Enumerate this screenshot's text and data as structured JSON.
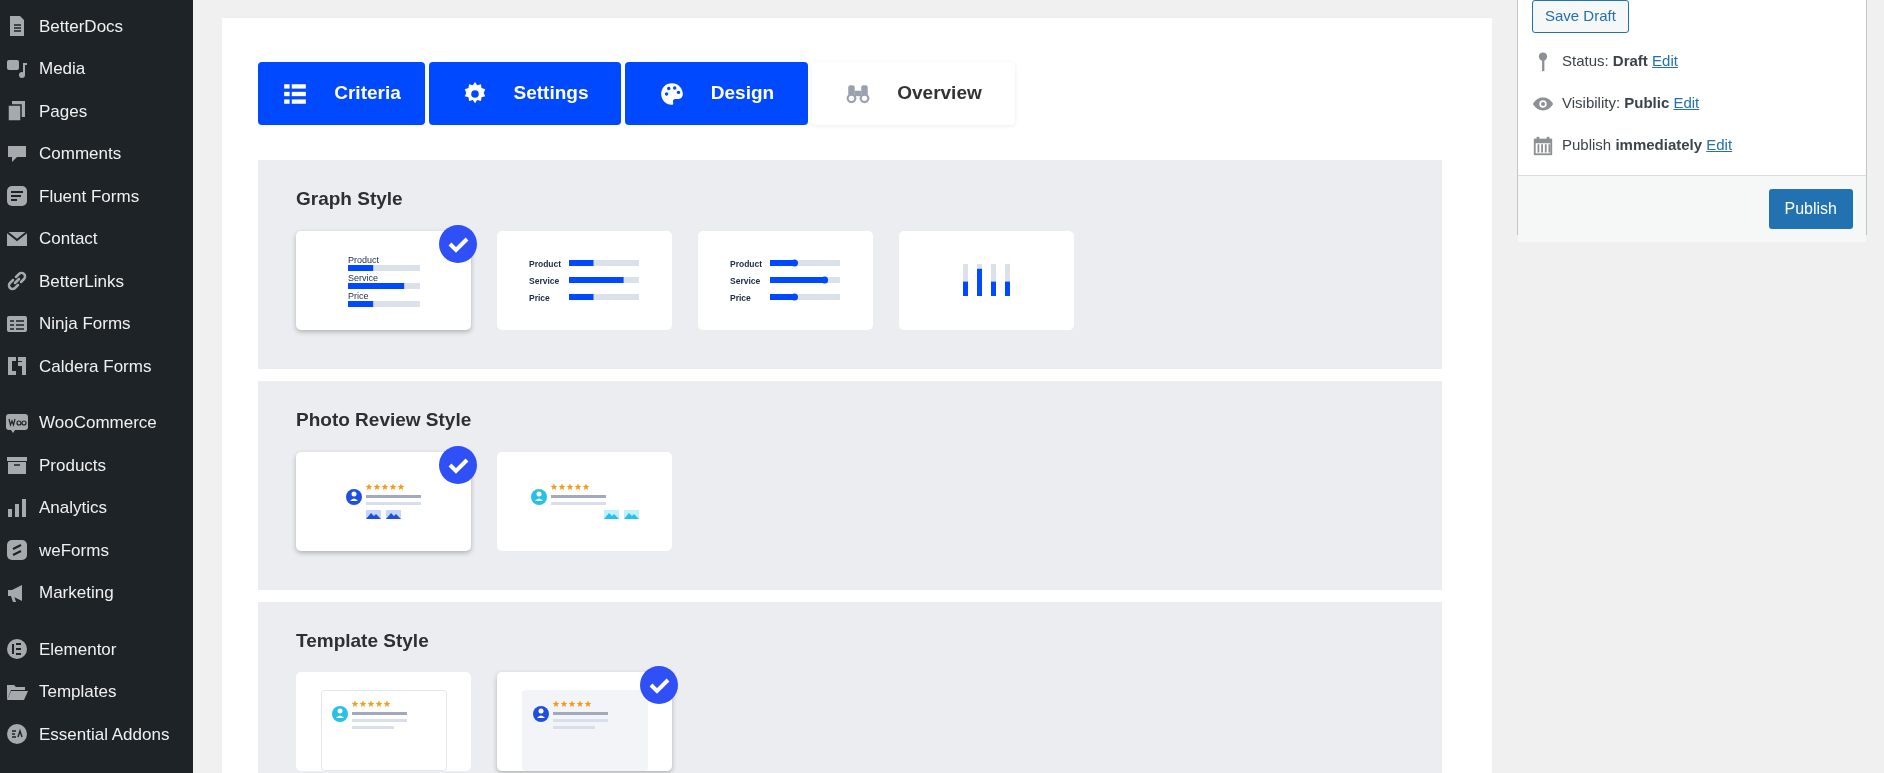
{
  "sidebar": {
    "items": [
      {
        "label": "BetterDocs"
      },
      {
        "label": "Media"
      },
      {
        "label": "Pages"
      },
      {
        "label": "Comments"
      },
      {
        "label": "Fluent Forms"
      },
      {
        "label": "Contact"
      },
      {
        "label": "BetterLinks"
      },
      {
        "label": "Ninja Forms"
      },
      {
        "label": "Caldera Forms"
      },
      {
        "label": "WooCommerce"
      },
      {
        "label": "Products"
      },
      {
        "label": "Analytics"
      },
      {
        "label": "weForms"
      },
      {
        "label": "Marketing"
      },
      {
        "label": "Elementor"
      },
      {
        "label": "Templates"
      },
      {
        "label": "Essential Addons"
      }
    ]
  },
  "tabs": [
    {
      "label": "Criteria",
      "active": true
    },
    {
      "label": "Settings",
      "active": true
    },
    {
      "label": "Design",
      "active": true
    },
    {
      "label": "Overview",
      "active": false
    }
  ],
  "sections": [
    {
      "title": "Graph Style",
      "kind": "graph",
      "options": [
        {
          "kind": "stacked",
          "selected": true,
          "labels": [
            "Product",
            "Service",
            "Price"
          ]
        },
        {
          "kind": "inline",
          "selected": false,
          "labels": [
            "Product",
            "Service",
            "Price"
          ]
        },
        {
          "kind": "slider",
          "selected": false,
          "labels": [
            "Product",
            "Service",
            "Price"
          ]
        },
        {
          "kind": "columns",
          "selected": false
        }
      ]
    },
    {
      "title": "Photo Review Style",
      "kind": "photo",
      "options": [
        {
          "kind": "left",
          "selected": true
        },
        {
          "kind": "right",
          "selected": false
        }
      ]
    },
    {
      "title": "Template Style",
      "kind": "template",
      "options": [
        {
          "kind": "plain",
          "selected": false
        },
        {
          "kind": "shaded",
          "selected": true
        }
      ]
    }
  ],
  "publish_box": {
    "save_button": "Save Draft",
    "rows": [
      {
        "label": "Status:",
        "value": "Draft",
        "link": "Edit"
      },
      {
        "label": "Visibility:",
        "value": "Public",
        "link": "Edit"
      },
      {
        "label": "Publish",
        "value": "immediately",
        "link": "Edit"
      }
    ],
    "publish_button": "Publish"
  }
}
